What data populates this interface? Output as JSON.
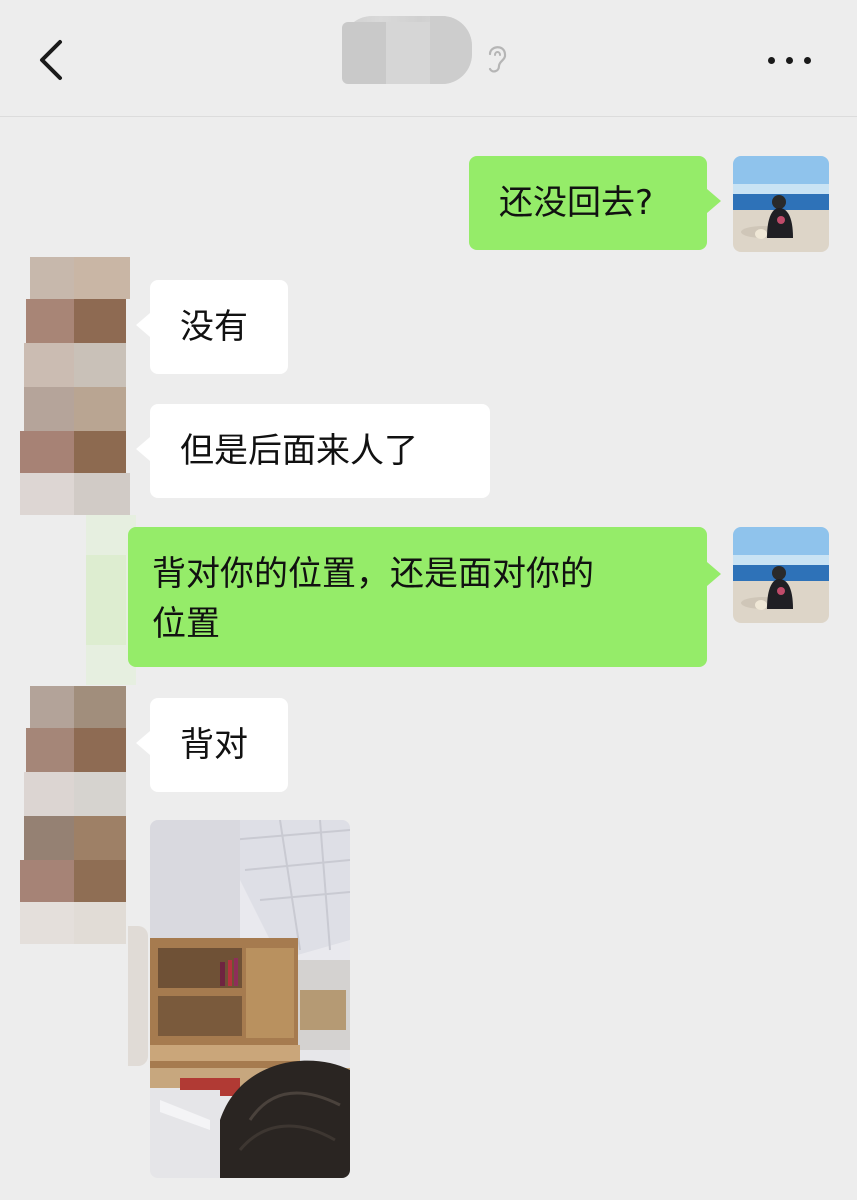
{
  "header": {
    "back_icon": "chevron-left-icon",
    "title_redacted": true,
    "voice_icon": "ear-icon",
    "more_icon": "ellipsis-icon"
  },
  "colors": {
    "background": "#ededed",
    "my_bubble": "#95ec69",
    "their_bubble": "#ffffff"
  },
  "messages": [
    {
      "sender": "me",
      "type": "text",
      "text": "还没回去?"
    },
    {
      "sender": "other",
      "type": "text",
      "text": "没有"
    },
    {
      "sender": "other",
      "type": "text",
      "text": "但是后面来人了"
    },
    {
      "sender": "me",
      "type": "text",
      "lines": [
        "背对你的位置，还是面对你的",
        "位置"
      ]
    },
    {
      "sender": "other",
      "type": "text",
      "text": "背对"
    },
    {
      "sender": "other",
      "type": "image",
      "description_icon": "office-photo"
    }
  ]
}
